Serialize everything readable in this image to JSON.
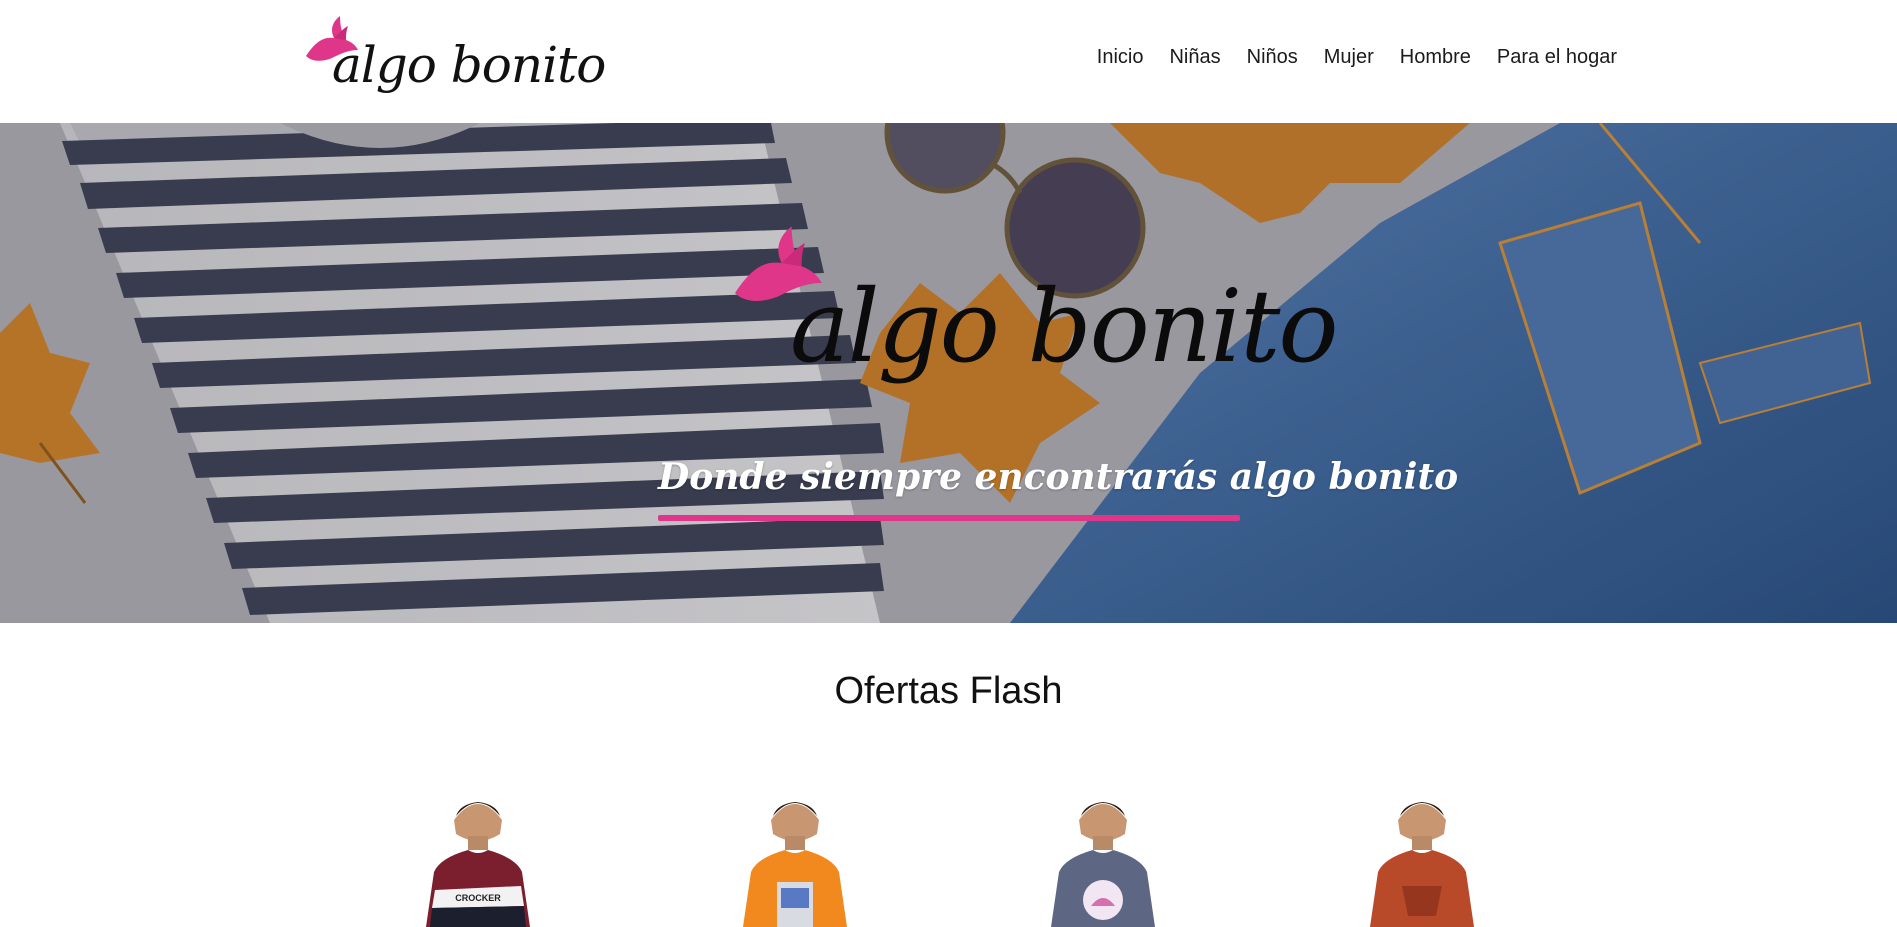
{
  "brand": {
    "name": "algo bonito",
    "accent_color": "#e0368a",
    "logo_icon": "bird-icon"
  },
  "nav": {
    "items": [
      {
        "label": "Inicio"
      },
      {
        "label": "Niñas"
      },
      {
        "label": "Niños"
      },
      {
        "label": "Mujer"
      },
      {
        "label": "Hombre"
      },
      {
        "label": "Para el hogar"
      }
    ]
  },
  "hero": {
    "logo_text": "algo bonito",
    "tagline": "Donde siempre encontrarás algo bonito"
  },
  "offers": {
    "title": "Ofertas Flash",
    "products": [
      {
        "shirt_color": "#7b1e2e",
        "print_text": "CROCKER"
      },
      {
        "shirt_color": "#f2891f",
        "print_text": ""
      },
      {
        "shirt_color": "#5d6784",
        "print_text": ""
      },
      {
        "shirt_color": "#b84a2a",
        "print_text": ""
      }
    ]
  }
}
